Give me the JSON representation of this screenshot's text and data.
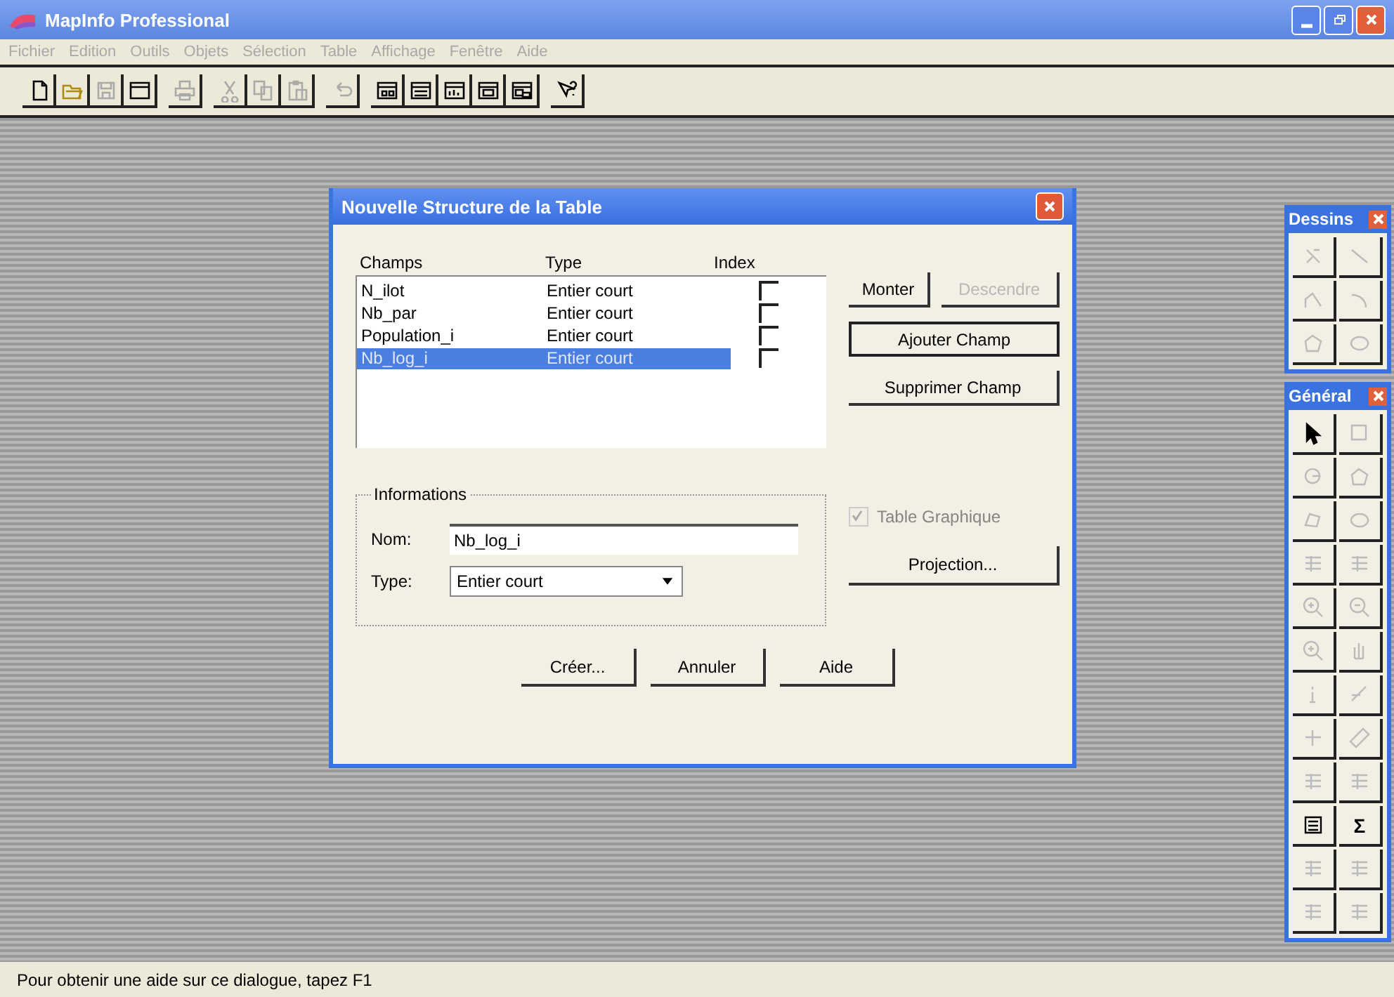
{
  "window": {
    "title": "MapInfo Professional"
  },
  "menu": [
    {
      "label": "Fichier",
      "disabled": true
    },
    {
      "label": "Edition",
      "disabled": true
    },
    {
      "label": "Outils",
      "disabled": true
    },
    {
      "label": "Objets",
      "disabled": true
    },
    {
      "label": "Sélection",
      "disabled": true
    },
    {
      "label": "Table",
      "disabled": true
    },
    {
      "label": "Affichage",
      "disabled": true
    },
    {
      "label": "Fenêtre",
      "disabled": true
    },
    {
      "label": "Aide",
      "disabled": true
    }
  ],
  "toolbar": [
    [
      {
        "kind": "new",
        "disabled": false
      },
      {
        "kind": "open",
        "disabled": false
      },
      {
        "kind": "save",
        "disabled": true
      },
      {
        "kind": "window",
        "disabled": false
      }
    ],
    [
      {
        "kind": "print",
        "disabled": true
      }
    ],
    [
      {
        "kind": "cut",
        "disabled": true
      },
      {
        "kind": "copy",
        "disabled": true
      },
      {
        "kind": "paste",
        "disabled": true
      }
    ],
    [
      {
        "kind": "undo",
        "disabled": true
      }
    ],
    [
      {
        "kind": "map",
        "disabled": false
      },
      {
        "kind": "browser",
        "disabled": false
      },
      {
        "kind": "graph",
        "disabled": false
      },
      {
        "kind": "layout",
        "disabled": false
      },
      {
        "kind": "redistrict",
        "disabled": false
      }
    ],
    [
      {
        "kind": "help",
        "disabled": false
      }
    ]
  ],
  "dialog": {
    "title": "Nouvelle Structure de la Table",
    "columns": [
      "Champs",
      "Type",
      "Index"
    ],
    "fields": [
      {
        "name": "N_ilot",
        "type": "Entier court",
        "index": false,
        "selected": false
      },
      {
        "name": "Nb_par",
        "type": "Entier court",
        "index": false,
        "selected": false
      },
      {
        "name": "Population_i",
        "type": "Entier court",
        "index": false,
        "selected": false
      },
      {
        "name": "Nb_log_i",
        "type": "Entier court",
        "index": false,
        "selected": true
      }
    ],
    "side_buttons": [
      {
        "label": "Monter",
        "disabled": false,
        "default": false
      },
      {
        "label": "Descendre",
        "disabled": true,
        "default": false
      },
      {
        "label": "Ajouter Champ",
        "disabled": false,
        "default": true
      },
      {
        "label": "Supprimer Champ",
        "disabled": false,
        "default": false
      }
    ],
    "group_title": "Informations",
    "name_label": "Nom:",
    "name_value": "Nb_log_i",
    "type_label": "Type:",
    "type_value": "Entier court",
    "graphic_table": {
      "label": "Table Graphique",
      "checked": true,
      "disabled": true
    },
    "projection_button": "Projection...",
    "buttons": [
      "Créer...",
      "Annuler",
      "Aide"
    ]
  },
  "palettes": [
    {
      "title": "Dessins",
      "tools": [
        {
          "kind": "symbol",
          "disabled": true
        },
        {
          "kind": "line",
          "disabled": true
        },
        {
          "kind": "polyline",
          "disabled": true
        },
        {
          "kind": "arc",
          "disabled": true
        },
        {
          "kind": "polygon",
          "disabled": true
        },
        {
          "kind": "ellipse",
          "disabled": true
        }
      ]
    },
    {
      "title": "Général",
      "tools": [
        {
          "kind": "arrow",
          "disabled": false
        },
        {
          "kind": "marquee",
          "disabled": true
        },
        {
          "kind": "radius",
          "disabled": true
        },
        {
          "kind": "polygon",
          "disabled": true
        },
        {
          "kind": "boundary",
          "disabled": true
        },
        {
          "kind": "ellipse",
          "disabled": true
        },
        {
          "kind": "grid",
          "disabled": true
        },
        {
          "kind": "grid",
          "disabled": true
        },
        {
          "kind": "zoomin",
          "disabled": true
        },
        {
          "kind": "zoomout",
          "disabled": true
        },
        {
          "kind": "zoomin",
          "disabled": true
        },
        {
          "kind": "hand",
          "disabled": true
        },
        {
          "kind": "info",
          "disabled": true
        },
        {
          "kind": "label",
          "disabled": true
        },
        {
          "kind": "drag",
          "disabled": true
        },
        {
          "kind": "ruler",
          "disabled": true
        },
        {
          "kind": "grid",
          "disabled": true
        },
        {
          "kind": "grid",
          "disabled": true
        },
        {
          "kind": "list",
          "disabled": false
        },
        {
          "kind": "glyph",
          "label": "Σ",
          "disabled": false
        },
        {
          "kind": "grid",
          "disabled": true
        },
        {
          "kind": "grid",
          "disabled": true
        },
        {
          "kind": "grid",
          "disabled": true
        },
        {
          "kind": "grid",
          "disabled": true
        }
      ]
    }
  ],
  "status_bar": "Pour obtenir une aide sur ce dialogue, tapez F1"
}
